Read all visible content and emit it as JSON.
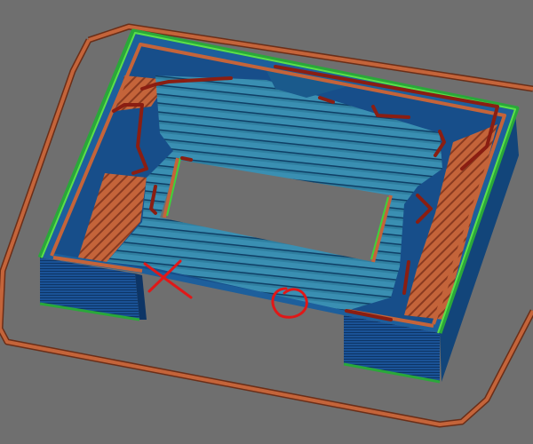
{
  "viewport": {
    "background": "#6f6f6f"
  },
  "colors": {
    "skirt": "#c4643a",
    "skirt_edge": "#6a2e18",
    "outer_wall": "#2d8a3a",
    "outer_wall_highlight": "#3fd23a",
    "wall_dark": "#0f3a66",
    "wall_mid": "#1c5aa0",
    "infill_blue": "#2f7fa0",
    "infill_blue_light": "#4aa0c0",
    "infill_orange": "#c4643a",
    "infill_orange_dark": "#8a3a20",
    "travel_red": "#8a1e12",
    "annotation_red": "#e01818",
    "hole": "#6f6f6f"
  },
  "annotations": [
    {
      "kind": "x-mark",
      "icon": "cross-mark-icon",
      "color": "#e01818"
    },
    {
      "kind": "circle-mark",
      "icon": "circle-mark-icon",
      "color": "#e01818"
    }
  ]
}
